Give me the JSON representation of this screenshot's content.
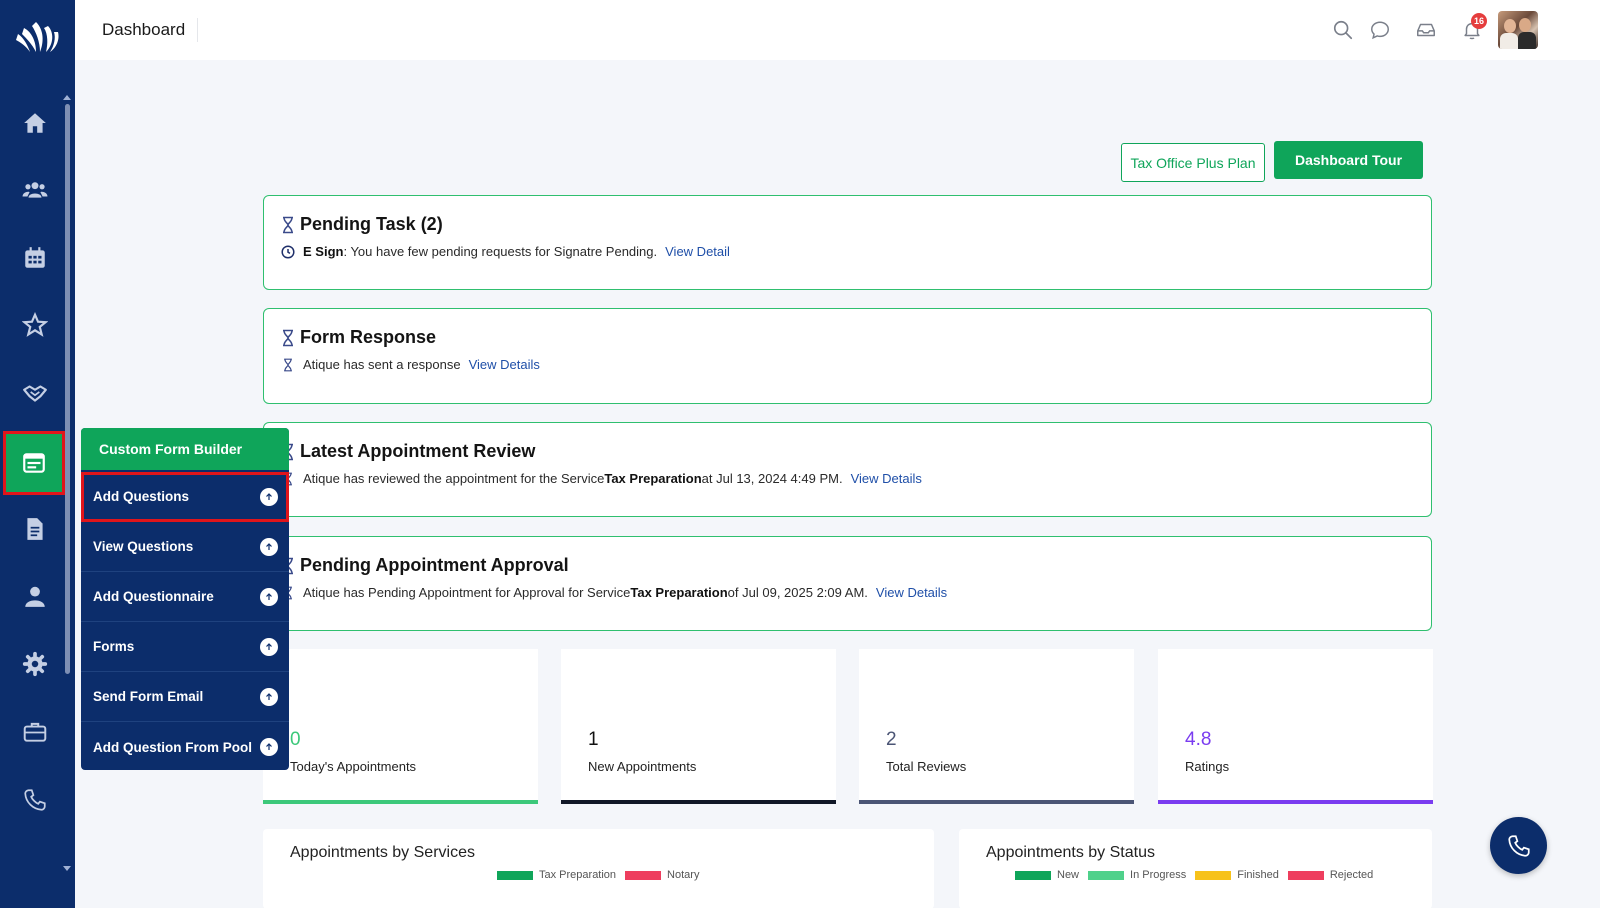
{
  "colors": {
    "brand_navy": "#0c2d6b",
    "brand_green": "#0fa55a",
    "highlight_red": "#e0151b",
    "link_blue": "#1f4fa8"
  },
  "sidebar": {
    "items": [
      {
        "name": "home-icon"
      },
      {
        "name": "users-icon"
      },
      {
        "name": "calendar-icon"
      },
      {
        "name": "star-icon"
      },
      {
        "name": "handshake-icon"
      },
      {
        "name": "form-builder-icon",
        "active": true
      },
      {
        "name": "document-icon"
      },
      {
        "name": "person-icon"
      },
      {
        "name": "gear-icon"
      },
      {
        "name": "briefcase-icon"
      },
      {
        "name": "phone-icon"
      }
    ]
  },
  "header": {
    "title": "Dashboard",
    "notification_count": "16"
  },
  "actions": {
    "plan_label": "Tax Office Plus Plan",
    "tour_label": "Dashboard Tour"
  },
  "cards": {
    "pending_task": {
      "title": "Pending Task (2)",
      "bold": "E Sign",
      "text": ": You have few pending requests for Signatre Pending.",
      "link": "View Detail"
    },
    "form_response": {
      "title": "Form Response",
      "text": "Atique has sent a response",
      "link": "View Details"
    },
    "latest_review": {
      "title": "Latest Appointment Review",
      "text1": "Atique has reviewed the appointment for the Service ",
      "bold": "Tax Preparation",
      "text2": " at Jul 13, 2024 4:49 PM.",
      "link": "View Details"
    },
    "pending_approval": {
      "title": "Pending Appointment Approval",
      "text1": "Atique has Pending Appointment for Approval for Service ",
      "bold": "Tax Preparation",
      "text2": " of Jul 09, 2025 2:09 AM.",
      "link": "View Details"
    }
  },
  "stats": [
    {
      "value": "0",
      "label": "Today's Appointments",
      "color": "#3cc87a"
    },
    {
      "value": "1",
      "label": "New Appointments",
      "color": "#111827"
    },
    {
      "value": "2",
      "label": "Total Reviews",
      "color": "#4b5575"
    },
    {
      "value": "4.8",
      "label": "Ratings",
      "color": "#7a3cf0"
    }
  ],
  "panels": {
    "by_services": {
      "title": "Appointments by Services",
      "legend": [
        {
          "label": "Tax Preparation",
          "color": "#0fa55a"
        },
        {
          "label": "Notary",
          "color": "#ee3e5e"
        }
      ]
    },
    "by_status": {
      "title": "Appointments by Status",
      "legend": [
        {
          "label": "New",
          "color": "#0fa55a"
        },
        {
          "label": "In Progress",
          "color": "#4fd18b"
        },
        {
          "label": "Finished",
          "color": "#f7c21b"
        },
        {
          "label": "Rejected",
          "color": "#ee3e5e"
        }
      ]
    }
  },
  "flyout": {
    "header": "Custom Form Builder",
    "items": [
      "Add Questions",
      "View Questions",
      "Add Questionnaire",
      "Forms",
      "Send Form Email",
      "Add Question From Pool"
    ]
  }
}
